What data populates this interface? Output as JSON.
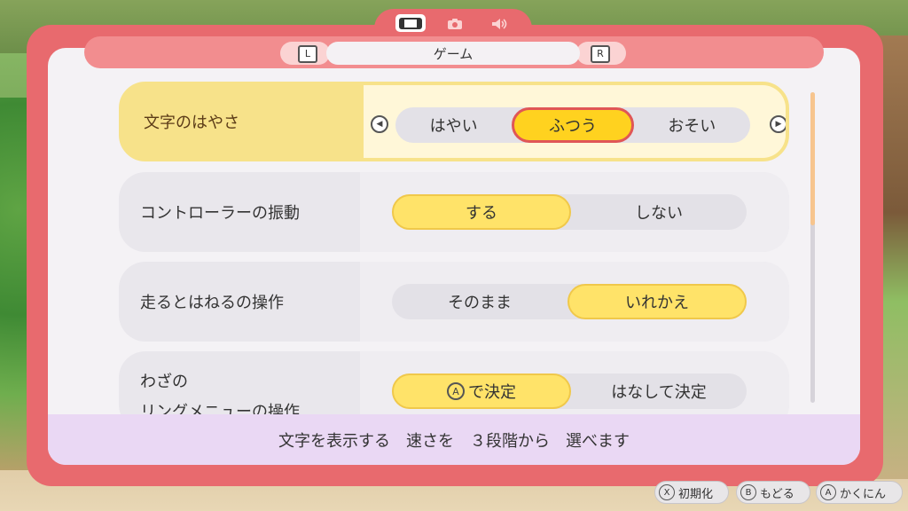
{
  "header": {
    "title": "ゲーム",
    "left_button": "L",
    "right_button": "R",
    "tabs": [
      {
        "icon": "console-icon",
        "active": true
      },
      {
        "icon": "camera-icon",
        "active": false
      },
      {
        "icon": "speaker-icon",
        "active": false
      }
    ]
  },
  "settings": [
    {
      "label": "文字のはやさ",
      "options": [
        "はやい",
        "ふつう",
        "おそい"
      ],
      "selected": "ふつう"
    },
    {
      "label": "コントローラーの振動",
      "options": [
        "する",
        "しない"
      ],
      "selected": "する"
    },
    {
      "label": "走るとはねるの操作",
      "options": [
        "そのまま",
        "いれかえ"
      ],
      "selected": "いれかえ"
    },
    {
      "label": "わざの",
      "label2": "リングメニューの操作",
      "option_badge": "A",
      "options": [
        "で決定",
        "はなして決定"
      ],
      "selected": "で決定"
    }
  ],
  "description": "文字を表示する　速さを　３段階から　選べます",
  "footer": [
    {
      "key": "X",
      "label": "初期化"
    },
    {
      "key": "B",
      "label": "もどる"
    },
    {
      "key": "A",
      "label": "かくにん"
    }
  ],
  "colors": {
    "frame": "#e86a6e",
    "accent_yellow": "#ffd21f",
    "focus_border": "#e05656",
    "description_bg": "#ead8f4"
  }
}
